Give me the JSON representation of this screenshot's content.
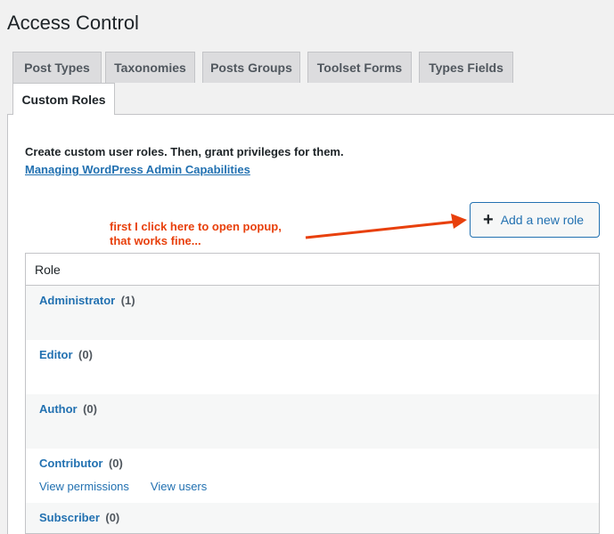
{
  "page": {
    "title": "Access Control"
  },
  "tabs": [
    {
      "label": "Post Types",
      "active": false
    },
    {
      "label": "Taxonomies",
      "active": false
    },
    {
      "label": "Posts Groups",
      "active": false
    },
    {
      "label": "Toolset Forms",
      "active": false
    },
    {
      "label": "Types Fields",
      "active": false
    },
    {
      "label": "Custom Roles",
      "active": true
    }
  ],
  "intro": {
    "text": "Create custom user roles. Then, grant privileges for them.",
    "link": "Managing WordPress Admin Capabilities"
  },
  "annotation": {
    "line1": "first I click here to open popup,",
    "line2": "that works fine..."
  },
  "add_button": {
    "icon": "plus-icon",
    "label": "Add a new role"
  },
  "table": {
    "header": "Role",
    "rows": [
      {
        "name": "Administrator",
        "count": "(1)"
      },
      {
        "name": "Editor",
        "count": "(0)"
      },
      {
        "name": "Author",
        "count": "(0)"
      },
      {
        "name": "Contributor",
        "count": "(0)",
        "actions": [
          "View permissions",
          "View users"
        ]
      },
      {
        "name": "Subscriber",
        "count": "(0)"
      }
    ]
  },
  "colors": {
    "accent": "#2271b1",
    "annotation": "#e8400c"
  }
}
